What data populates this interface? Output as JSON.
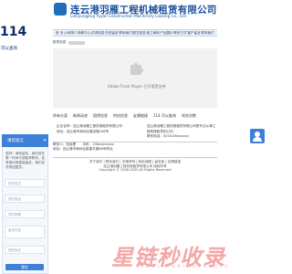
{
  "header": {
    "company_cn": "连云港羽雁工程机械租赁有限公司",
    "company_en": "Lianyungang Yuyan Construction Machinery Leasing Co., Ltd."
  },
  "sidebar": {
    "big_number": "114",
    "label": "可以查询"
  },
  "nav": {
    "items": [
      "首 页",
      "公司简介",
      "新闻中心",
      "供求信息",
      "在线留言",
      "联系我们",
      "图文信息",
      "施工案例",
      "产品展示",
      "联系方式",
      "客户留言",
      "联系我们"
    ]
  },
  "subnav": {
    "label": "租赁信息"
  },
  "flash": {
    "message": "Adobe Flash Player 已不再受支持"
  },
  "infobar": {
    "items": [
      "所有分类",
      "新闻动态",
      "租赁信息",
      "供应信息",
      "友情链接",
      "114 可以查询",
      "浏览次数"
    ]
  },
  "details": {
    "left_lines": [
      "企业名称：连云港羽雁工程机械租赁有限公司",
      "地址：连云港市海州区建设路108号"
    ],
    "right_lines": [
      "连云港羽雁工程机械租赁有限公司是专业从事工程机械租赁的公司",
      "联系电话：0518-85xxxxxx"
    ]
  },
  "contact": {
    "lines": [
      "联系人：张经理　　手机：138xxxxxxxx",
      "地址：连云港市海州区新建东路88号附近"
    ]
  },
  "footer": {
    "line1": "关于我们 | 联系我们 | 法律声明 | 网站地图 | 留言板 | 友情链接",
    "line2": "连云港羽雁工程机械租赁有限公司 版权所有",
    "line3": "Copyright © 2008-2025 All Rights Reserved"
  },
  "chat": {
    "title": "请您留言",
    "message": "您好！请您留言，我们将在第一时间与您取得联系。如有疑问请直接留言，我们会尽快回复您。",
    "name_placeholder": "您的姓名",
    "phone_placeholder": "您的电话",
    "email_placeholder": "您的邮箱",
    "content_placeholder": "留言内容",
    "address_placeholder": "您的地址",
    "submit_label": "提交"
  },
  "watermark": {
    "brand": "星链秒收录",
    "brand_sub": "XINGLIANMIAOSHOULU"
  },
  "colors": {
    "primary": "#1f6fb8",
    "chat_blue": "#3e7fd8",
    "watermark": "#f3a9a8"
  }
}
